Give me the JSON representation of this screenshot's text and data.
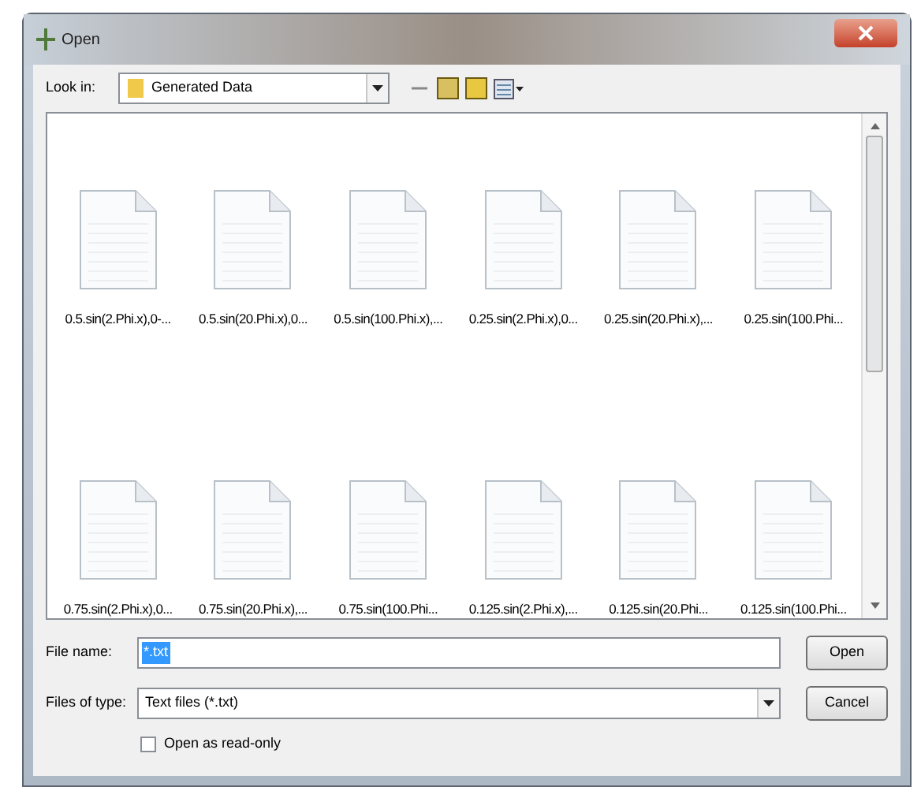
{
  "window": {
    "title": "Open"
  },
  "look_in": {
    "label": "Look in:",
    "value": "Generated Data"
  },
  "files": [
    {
      "name": "0.5.sin(2.Phi.x),0-..."
    },
    {
      "name": "0.5.sin(20.Phi.x),0..."
    },
    {
      "name": "0.5.sin(100.Phi.x),..."
    },
    {
      "name": "0.25.sin(2.Phi.x),0..."
    },
    {
      "name": "0.25.sin(20.Phi.x),..."
    },
    {
      "name": "0.25.sin(100.Phi..."
    },
    {
      "name": "0.75.sin(2.Phi.x),0..."
    },
    {
      "name": "0.75.sin(20.Phi.x),..."
    },
    {
      "name": "0.75.sin(100.Phi..."
    },
    {
      "name": "0.125.sin(2.Phi.x),..."
    },
    {
      "name": "0.125.sin(20.Phi..."
    },
    {
      "name": "0.125.sin(100.Phi..."
    }
  ],
  "file_name": {
    "label": "File name:",
    "value": "*.txt",
    "selected": true
  },
  "file_type": {
    "label": "Files of type:",
    "value": "Text files (*.txt)"
  },
  "read_only": {
    "label": "Open as read-only",
    "checked": false
  },
  "buttons": [
    {
      "label": "Open"
    },
    {
      "label": "Cancel"
    }
  ]
}
